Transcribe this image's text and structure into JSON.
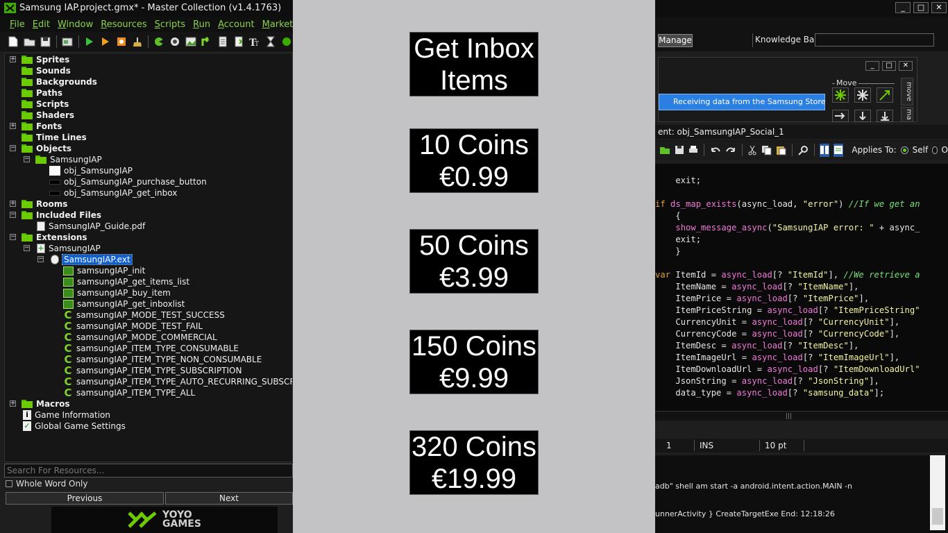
{
  "window": {
    "title": "Samsung IAP.project.gmx*  -  Master Collection (v1.4.1763)",
    "minimize": "_",
    "maximize": "□",
    "close": "✕"
  },
  "menu": [
    {
      "mnemonic": "F",
      "rest": "ile"
    },
    {
      "mnemonic": "E",
      "rest": "dit"
    },
    {
      "mnemonic": "W",
      "rest": "indow"
    },
    {
      "mnemonic": "R",
      "rest": "esources"
    },
    {
      "mnemonic": "S",
      "rest": "cripts"
    },
    {
      "mnemonic": "R",
      "rest": "un"
    },
    {
      "mnemonic": "A",
      "rest": "ccount"
    },
    {
      "mnemonic": "M",
      "rest": "arketplace Beta"
    }
  ],
  "tree": {
    "sprites": "Sprites",
    "sounds": "Sounds",
    "backgrounds": "Backgrounds",
    "paths": "Paths",
    "scripts": "Scripts",
    "shaders": "Shaders",
    "fonts": "Fonts",
    "time_lines": "Time Lines",
    "objects": "Objects",
    "objects_group": "SamsungIAP",
    "objects_items": [
      "obj_SamsungIAP",
      "obj_SamsungIAP_purchase_button",
      "obj_SamsungIAP_get_inbox"
    ],
    "rooms": "Rooms",
    "included_files": "Included Files",
    "included_item": "SamsungIAP_Guide.pdf",
    "extensions": "Extensions",
    "ext_group": "SamsungIAP",
    "ext_file": "SamsungIAP.ext",
    "ext_functions": [
      "samsungIAP_init",
      "samsungIAP_get_items_list",
      "samsungIAP_buy_item",
      "samsungIAP_get_inboxlist"
    ],
    "ext_constants": [
      "samsungIAP_MODE_TEST_SUCCESS",
      "samsungIAP_MODE_TEST_FAIL",
      "samsungIAP_MODE_COMMERCIAL",
      "samsungIAP_ITEM_TYPE_CONSUMABLE",
      "samsungIAP_ITEM_TYPE_NON_CONSUMABLE",
      "samsungIAP_ITEM_TYPE_SUBSCRIPTION",
      "samsungIAP_ITEM_TYPE_AUTO_RECURRING_SUBSCRIPTIO",
      "samsungIAP_ITEM_TYPE_ALL"
    ],
    "macros": "Macros",
    "game_information": "Game Information",
    "global_game_settings": "Global Game Settings"
  },
  "search": {
    "placeholder": "Search For Resources...",
    "whole_word": "Whole Word Only",
    "previous": "Previous",
    "next": "Next"
  },
  "brand": {
    "line1": "YOYO",
    "line2": "GAMES"
  },
  "game": {
    "inbox": [
      "Get Inbox",
      "Items"
    ],
    "products": [
      [
        "10 Coins",
        "€0.99"
      ],
      [
        "50 Coins",
        "€3.99"
      ],
      [
        "150 Coins",
        "€9.99"
      ],
      [
        "320 Coins",
        "€19.99"
      ]
    ]
  },
  "right": {
    "manage": "Manage",
    "knowledge_base": "Knowledge Base:",
    "receiving": "Receiving data from the Samsung Store",
    "move_label": "Move",
    "tab_move": "move",
    "tab_main": "ma",
    "code_title": "ent: obj_SamsungIAP_Social_1",
    "applies_to": "Applies To:",
    "self": "Self",
    "other": "O"
  },
  "code": {
    "l01": "    exit;",
    "l02a": "if ",
    "l02b": "ds_map_exists",
    "l02c": "(async_load, ",
    "l02d": "\"error\"",
    "l02e": ") ",
    "l02f": "//If we get an",
    "l03": "    {",
    "l04a": "    ",
    "l04b": "show_message_async",
    "l04c": "(",
    "l04d": "\"SamsungIAP error: \"",
    "l04e": " + async_",
    "l05": "    exit;",
    "l06": "    }",
    "vars": [
      {
        "pre": "var ",
        "name": "ItemId",
        "key": "\"ItemId\"",
        "tail": "], ",
        "comment": "//We retrieve a"
      },
      {
        "pre": "    ",
        "name": "ItemName",
        "key": "\"ItemName\"",
        "tail": "],",
        "comment": ""
      },
      {
        "pre": "    ",
        "name": "ItemPrice",
        "key": "\"ItemPrice\"",
        "tail": "],",
        "comment": ""
      },
      {
        "pre": "    ",
        "name": "ItemPriceString",
        "key": "\"ItemPriceString\"",
        "tail": "",
        "comment": ""
      },
      {
        "pre": "    ",
        "name": "CurrencyUnit",
        "key": "\"CurrencyUnit\"",
        "tail": "],",
        "comment": ""
      },
      {
        "pre": "    ",
        "name": "CurrencyCode",
        "key": "\"CurrencyCode\"",
        "tail": "],",
        "comment": ""
      },
      {
        "pre": "    ",
        "name": "ItemDesc",
        "key": "\"ItemDesc\"",
        "tail": "],",
        "comment": ""
      },
      {
        "pre": "    ",
        "name": "ItemImageUrl",
        "key": "\"ItemImageUrl\"",
        "tail": "],",
        "comment": ""
      },
      {
        "pre": "    ",
        "name": "ItemDownloadUrl",
        "key": "\"ItemDownloadUrl\"",
        "tail": "",
        "comment": ""
      },
      {
        "pre": "    ",
        "name": "JsonString",
        "key": "\"JsonString\"",
        "tail": "],",
        "comment": ""
      },
      {
        "pre": "    ",
        "name": "data_type",
        "key": "\"samsung_data\"",
        "tail": "];",
        "comment": ""
      }
    ],
    "assign": " = ",
    "accessor": "async_load",
    "bracket": "[? "
  },
  "status": {
    "line": "1",
    "mode": "INS",
    "font_size": "10 pt"
  },
  "output": {
    "line1": "adb\" shell am start -a android.intent.action.MAIN -n",
    "line2": "unnerActivity } CreateTargetExe End: 12:18:26"
  },
  "colors": {
    "accent_green": "#6ccb00",
    "menu_green": "#8bd34a",
    "selection_blue": "#1060d0"
  }
}
